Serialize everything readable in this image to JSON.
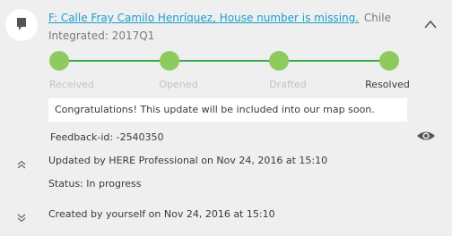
{
  "header": {
    "title_link": "F: Calle Fray Camilo Henríquez, House number is missing.",
    "country": "Chile",
    "subtitle": "Integrated: 2017Q1",
    "avatar_icon": "speech-bubble-icon",
    "collapse_icon": "chevron-up-icon"
  },
  "progress": {
    "steps": [
      {
        "label": "Received"
      },
      {
        "label": "Opened"
      },
      {
        "label": "Drafted"
      },
      {
        "label": "Resolved"
      }
    ],
    "active_label": "Resolved",
    "line_color": "#3aa54a",
    "dot_color": "#8dcb5f"
  },
  "notice": "Congratulations! This update will be included into our map soon.",
  "feedback": {
    "text": "Feedback-id: -2540350",
    "view_icon": "eye-icon"
  },
  "history": [
    {
      "icon": "double-chevron-up-icon",
      "text": "Updated by HERE Professional on Nov 24, 2016 at 15:10"
    },
    {
      "icon": null,
      "text": "Status: In progress"
    },
    {
      "icon": "double-chevron-down-icon",
      "text": "Created by yourself on Nov 24, 2016 at 15:10"
    }
  ],
  "colors": {
    "link": "#18a0c9",
    "background": "#efeff0"
  }
}
